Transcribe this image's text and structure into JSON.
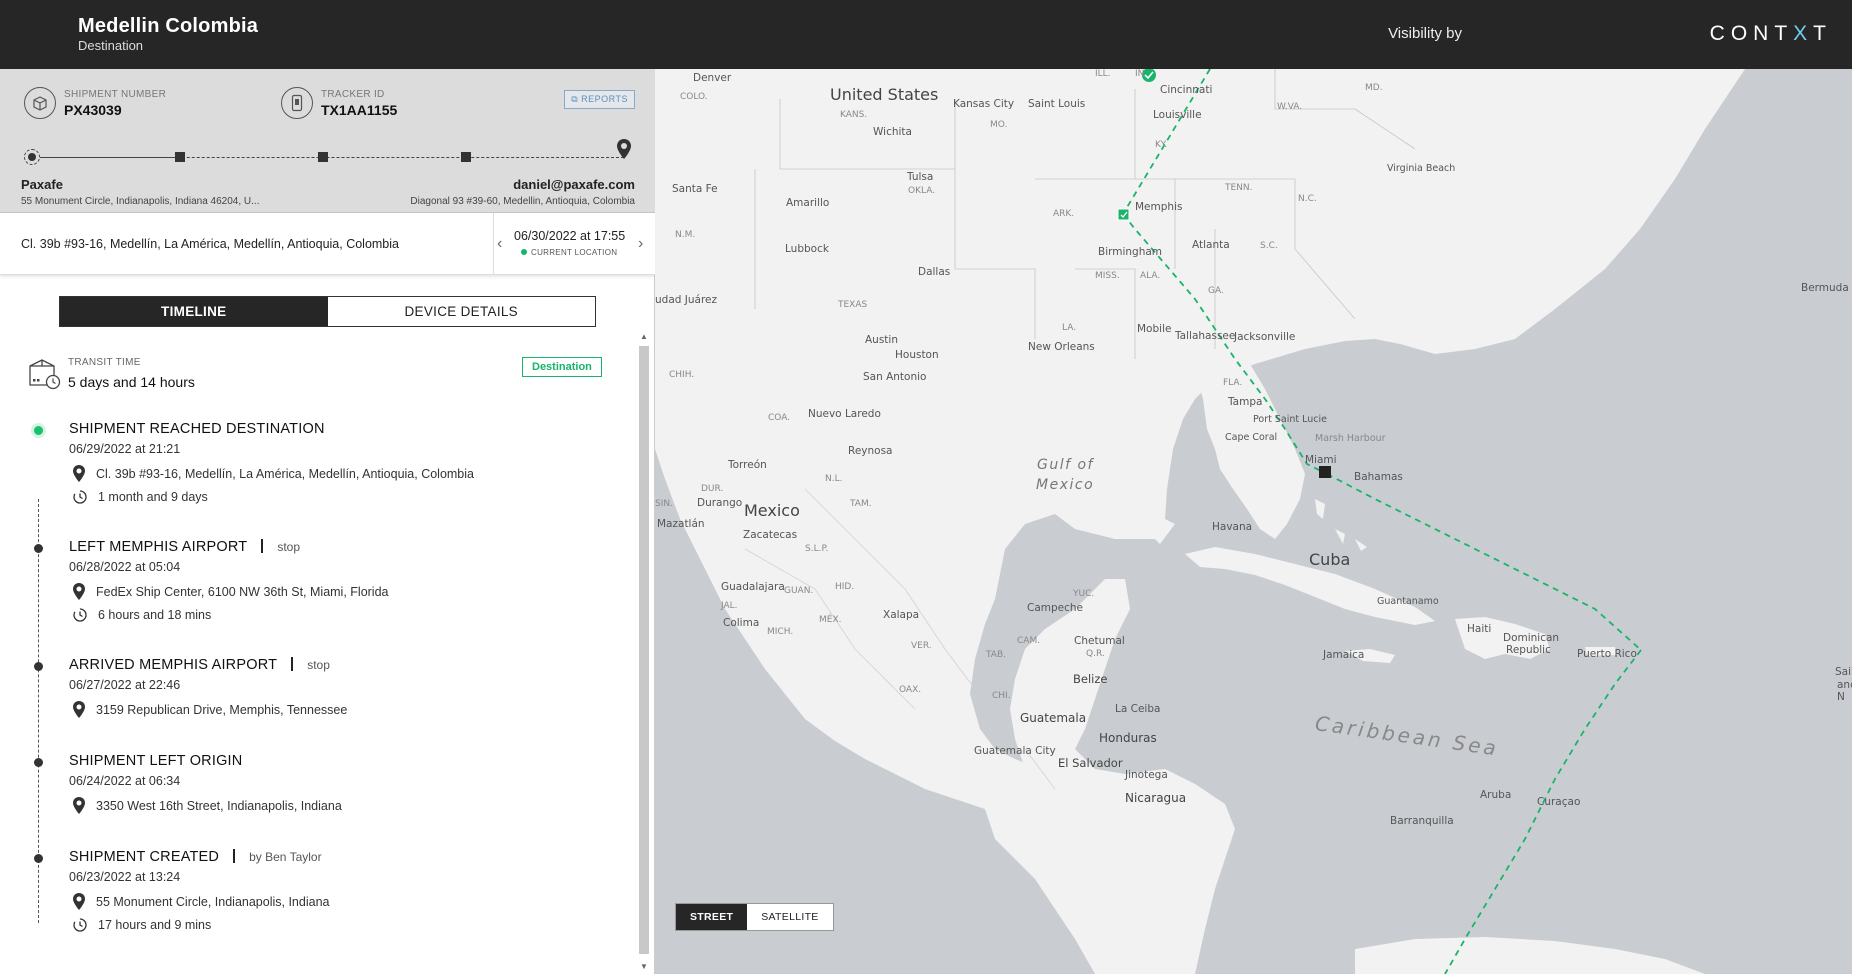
{
  "header": {
    "title": "Medellin Colombia",
    "subtitle": "Destination",
    "visibility_label": "Visibility by",
    "brand_pre": "CONT",
    "brand_x": "X",
    "brand_post": "T"
  },
  "shipment": {
    "shipment_number_label": "SHIPMENT NUMBER",
    "shipment_number": "PX43039",
    "tracker_id_label": "TRACKER ID",
    "tracker_id": "TX1AA1155",
    "reports_label": "REPORTS",
    "origin_name": "Paxafe",
    "origin_address": "55 Monument Circle, Indianapolis, Indiana 46204, U...",
    "destination_name": "daniel@paxafe.com",
    "destination_address": "Diagonal 93 #39-60, Medellin, Antioquia, Colombia"
  },
  "location": {
    "address": "Cl. 39b #93-16, Medellín, La América, Medellín, Antioquia, Colombia",
    "datetime": "06/30/2022 at 17:55",
    "current_label": "CURRENT LOCATION"
  },
  "tabs": {
    "timeline": "TIMELINE",
    "device_details": "DEVICE DETAILS"
  },
  "transit": {
    "label": "TRANSIT TIME",
    "value": "5 days and 14 hours",
    "badge": "Destination"
  },
  "timeline": [
    {
      "title": "SHIPMENT REACHED DESTINATION",
      "aux": "",
      "time": "06/29/2022 at 21:21",
      "address": "Cl. 39b #93-16, Medellín, La América, Medellín, Antioquia, Colombia",
      "duration": "1 month and 9 days"
    },
    {
      "title": "LEFT MEMPHIS AIRPORT",
      "aux": "stop",
      "time": "06/28/2022 at 05:04",
      "address": "FedEx Ship Center, 6100 NW 36th St, Miami, Florida",
      "duration": "6 hours and 18 mins"
    },
    {
      "title": "ARRIVED MEMPHIS AIRPORT",
      "aux": "stop",
      "time": "06/27/2022 at 22:46",
      "address": "3159 Republican Drive, Memphis, Tennessee",
      "duration": ""
    },
    {
      "title": "SHIPMENT LEFT ORIGIN",
      "aux": "",
      "time": "06/24/2022 at 06:34",
      "address": "3350 West 16th Street, Indianapolis, Indiana",
      "duration": ""
    },
    {
      "title": "SHIPMENT CREATED",
      "aux": "by Ben Taylor",
      "time": "06/23/2022 at 13:24",
      "address": "55 Monument Circle, Indianapolis, Indiana",
      "duration": "17 hours and 9 mins"
    }
  ],
  "map": {
    "street_label": "STREET",
    "satellite_label": "SATELLITE",
    "route_color": "#18b46a",
    "water_color": "#c9cdd1",
    "land_color": "#f2f2f2",
    "labels": {
      "us": "United States",
      "denver": "Denver",
      "colo": "COLO.",
      "kansas_city": "Kansas City",
      "saint_louis": "Saint Louis",
      "ill": "ILL.",
      "in": "IN",
      "cincinnati": "Cincinnati",
      "md": "MD.",
      "wva": "W.VA.",
      "kans": "KANS.",
      "mo": "MO.",
      "louisville": "Louisville",
      "ky": "KY.",
      "wichita": "Wichita",
      "virginia_beach": "Virginia Beach",
      "tulsa": "Tulsa",
      "santa_fe": "Santa Fe",
      "amarillo": "Amarillo",
      "okla": "OKLA.",
      "tenn": "TENN.",
      "nc": "N.C.",
      "memphis": "Memphis",
      "ark": "ARK.",
      "nm": "N.M.",
      "lubbock": "Lubbock",
      "birmingham": "Birmingham",
      "atlanta": "Atlanta",
      "sc": "S.C.",
      "dallas": "Dallas",
      "miss": "MISS.",
      "ala": "ALA.",
      "ga": "GA.",
      "bermuda": "Bermuda",
      "juarez": "udad Juárez",
      "texas": "TEXAS",
      "la": "LA.",
      "mobile": "Mobile",
      "tallahassee": "Tallahassee",
      "jacksonville": "Jacksonville",
      "austin": "Austin",
      "houston": "Houston",
      "new_orleans": "New Orleans",
      "san_antonio": "San Antonio",
      "chih": "CHIH.",
      "fla": "FLA.",
      "tampa": "Tampa",
      "port_saint_lucie": "Port Saint Lucie",
      "coa": "COA.",
      "nuevo_laredo": "Nuevo Laredo",
      "cape_coral": "Cape Coral",
      "marsh_harbour": "Marsh Harbour",
      "miami": "Miami",
      "reynosa": "Reynosa",
      "gulf1": "Gulf of",
      "gulf2": "Mexico",
      "torreon": "Torreón",
      "nl": "N.L.",
      "bahamas": "Bahamas",
      "dur": "DUR.",
      "durango": "Durango",
      "sin": "SIN.",
      "tam": "TAM.",
      "mexico": "Mexico",
      "mazatlan": "Mazatlán",
      "zacatecas": "Zacatecas",
      "havana": "Havana",
      "slp": "S.L.P.",
      "cuba": "Cuba",
      "guadalajara": "Guadalajara",
      "guan": "GUAN.",
      "hid": "HID.",
      "jal": "JAL.",
      "yuc": "YUC.",
      "guantanamo": "Guantanamo",
      "mex": "MÉX.",
      "campeche": "Campeche",
      "colima": "Colima",
      "mich": "MICH.",
      "xalapa": "Xalapa",
      "haiti": "Haiti",
      "dominican1": "Dominican",
      "dominican2": "Republic",
      "cam": "CAM.",
      "chetumal": "Chetumal",
      "qr": "Q.R.",
      "ver": "VER.",
      "puerto_rico": "Puerto Rico",
      "jamaica": "Jamaica",
      "saint1": "Saint",
      "saint2": "and N",
      "tab": "TAB.",
      "belize": "Belize",
      "oax": "OAX.",
      "chi": "CHI.",
      "la_ceiba": "La Ceiba",
      "guatemala": "Guatemala",
      "caribbean": "Caribbean Sea",
      "honduras": "Honduras",
      "guatemala_city": "Guatemala City",
      "el_salvador": "El Salvador",
      "jinotega": "Jinotega",
      "nicaragua": "Nicaragua",
      "aruba": "Aruba",
      "curacao": "Curaçao",
      "barranquilla": "Barranquilla"
    }
  }
}
